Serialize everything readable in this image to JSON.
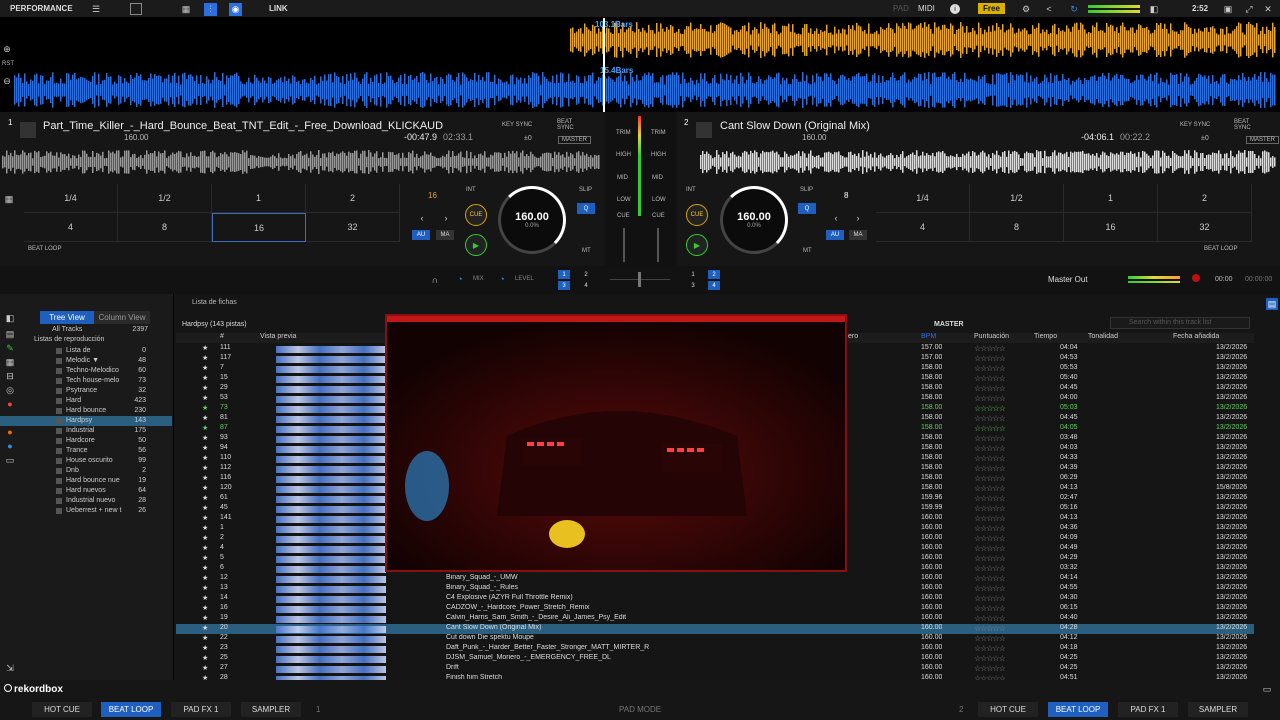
{
  "topbar": {
    "mode": "PERFORMANCE",
    "link": "LINK",
    "pad": "PAD",
    "midi": "MIDI",
    "plan": "Free",
    "time": "2:52"
  },
  "waveform": {
    "deckA_bars": "103.1Bars",
    "deckB_bars": "15.4Bars",
    "rst": "RST"
  },
  "deck1": {
    "num": "1",
    "title": "Part_Time_Killer_-_Hard_Bounce_Beat_TNT_Edit_-_Free_Download_KLICKAUD",
    "bpm_small": "160.00",
    "remaining": "-00:47.9",
    "elapsed": "02:33.1",
    "key_sync": "KEY SYNC",
    "beat_sync": "BEAT SYNC",
    "pm": "±0",
    "master": "MASTER",
    "pads": [
      "1/4",
      "1/2",
      "1",
      "2",
      "4",
      "8",
      "16",
      "32"
    ],
    "selected_pad": 6,
    "loop_size": "16",
    "int": "INT",
    "cue": "CUE",
    "slip": "SLIP",
    "q": "Q",
    "au": "AU",
    "ma": "MA",
    "mt": "MT",
    "bpm": "160.00",
    "pitch": "0.0%",
    "pitch_range": "±6",
    "beat_loop": "BEAT LOOP"
  },
  "deck2": {
    "num": "2",
    "title": "Cant Slow Down (Original Mix)",
    "bpm_small": "160.00",
    "remaining": "-04:06.1",
    "elapsed": "00:22.2",
    "key_sync": "KEY SYNC",
    "beat_sync": "BEAT SYNC",
    "pm": "±0",
    "master": "MASTER",
    "pads": [
      "1/4",
      "1/2",
      "1",
      "2",
      "4",
      "8",
      "16",
      "32"
    ],
    "loop_size": "8",
    "int": "INT",
    "cue": "CUE",
    "slip": "SLIP",
    "q": "Q",
    "au": "AU",
    "ma": "MA",
    "mt": "MT",
    "bpm": "160.00",
    "pitch": "0.0%",
    "pitch_range": "±6",
    "beat_loop": "BEAT LOOP"
  },
  "mixer": {
    "trim": "TRIM",
    "high": "HIGH",
    "mid": "MID",
    "low": "LOW",
    "cue": "CUE",
    "mix": "MIX",
    "level": "LEVEL",
    "master_out": "Master Out",
    "clock": "00:00",
    "clock2": "00:00:00",
    "fx": [
      "1",
      "2",
      "3",
      "4"
    ]
  },
  "browser": {
    "tree_view": "Tree View",
    "column_view": "Column View",
    "list_label": "Lista de fichas",
    "playlist_label": "Hardpsy (143 pistas)",
    "master": "MASTER",
    "search_placeholder": "Search within this track list",
    "all_tracks": {
      "label": "All Tracks",
      "count": "2397"
    },
    "playlists_label": "Listas de reproducción",
    "playlists": [
      {
        "l": "Lista de",
        "c": "0"
      },
      {
        "l": "Melodic ▼",
        "c": "48"
      },
      {
        "l": "Techno-Melodico",
        "c": "60"
      },
      {
        "l": "Tech house-melo",
        "c": "73"
      },
      {
        "l": "Psytrance",
        "c": "32"
      },
      {
        "l": "Hard",
        "c": "423"
      },
      {
        "l": "Hard bounce",
        "c": "230"
      },
      {
        "l": "Hardpsy",
        "c": "143"
      },
      {
        "l": "Industrial",
        "c": "175"
      },
      {
        "l": "Hardcore",
        "c": "50"
      },
      {
        "l": "Trance",
        "c": "56"
      },
      {
        "l": "House oscurito",
        "c": "99"
      },
      {
        "l": "Dnb",
        "c": "2"
      },
      {
        "l": "Hard bounce nue",
        "c": "19"
      },
      {
        "l": "Hard nuevos",
        "c": "64"
      },
      {
        "l": "Industrial nuevo",
        "c": "28"
      },
      {
        "l": "Ueberrest + new t",
        "c": "26"
      }
    ],
    "columns": {
      "num": "#",
      "preview": "Vista previa",
      "genre": "ero",
      "bpm": "BPM",
      "rating": "Puntuación",
      "time": "Tiempo",
      "key": "Tonalidad",
      "date": "Fecha añadida"
    },
    "rows": [
      {
        "n": "111",
        "t": "",
        "b": "157.00",
        "d": "04:04",
        "f": "13/2/2026"
      },
      {
        "n": "117",
        "t": "",
        "b": "157.00",
        "d": "04:53",
        "f": "13/2/2026"
      },
      {
        "n": "7",
        "t": "",
        "b": "158.00",
        "d": "05:53",
        "f": "13/2/2026"
      },
      {
        "n": "15",
        "t": "",
        "b": "158.00",
        "d": "05:40",
        "f": "13/2/2026"
      },
      {
        "n": "29",
        "t": "",
        "b": "158.00",
        "d": "04:45",
        "f": "13/2/2026"
      },
      {
        "n": "53",
        "t": "",
        "b": "158.00",
        "d": "04:00",
        "f": "13/2/2026"
      },
      {
        "n": "73",
        "t": "",
        "b": "158.00",
        "d": "05:03",
        "f": "13/2/2026",
        "g": true
      },
      {
        "n": "81",
        "t": "",
        "b": "158.00",
        "d": "04:45",
        "f": "13/2/2026"
      },
      {
        "n": "87",
        "t": "",
        "b": "158.00",
        "d": "04:05",
        "f": "13/2/2026",
        "g": true
      },
      {
        "n": "93",
        "t": "",
        "b": "158.00",
        "d": "03:48",
        "f": "13/2/2026"
      },
      {
        "n": "94",
        "t": "",
        "b": "158.00",
        "d": "04:03",
        "f": "13/2/2026"
      },
      {
        "n": "110",
        "t": "",
        "b": "158.00",
        "d": "04:33",
        "f": "13/2/2026"
      },
      {
        "n": "112",
        "t": "",
        "b": "158.00",
        "d": "04:39",
        "f": "13/2/2026"
      },
      {
        "n": "116",
        "t": "",
        "b": "158.00",
        "d": "06:29",
        "f": "13/2/2026"
      },
      {
        "n": "120",
        "t": "",
        "b": "158.00",
        "d": "04:13",
        "f": "15/8/2026"
      },
      {
        "n": "61",
        "t": "",
        "b": "159.96",
        "d": "02:47",
        "f": "13/2/2026"
      },
      {
        "n": "45",
        "t": "",
        "b": "159.99",
        "d": "05:16",
        "f": "13/2/2026"
      },
      {
        "n": "141",
        "t": "",
        "b": "160.00",
        "d": "04:13",
        "f": "13/2/2026"
      },
      {
        "n": "1",
        "t": "",
        "b": "160.00",
        "d": "04:36",
        "f": "13/2/2026"
      },
      {
        "n": "2",
        "t": "",
        "b": "160.00",
        "d": "04:09",
        "f": "13/2/2026"
      },
      {
        "n": "4",
        "t": "",
        "b": "160.00",
        "d": "04:49",
        "f": "13/2/2026"
      },
      {
        "n": "5",
        "t": "",
        "b": "160.00",
        "d": "04:29",
        "f": "13/2/2026"
      },
      {
        "n": "6",
        "t": "",
        "b": "160.00",
        "d": "03:32",
        "f": "13/2/2026"
      },
      {
        "n": "12",
        "t": "Binary_Squad_-_UMW",
        "b": "160.00",
        "d": "04:14",
        "f": "13/2/2026"
      },
      {
        "n": "13",
        "t": "Binary_Squad_-_Rules",
        "b": "160.00",
        "d": "04:55",
        "f": "13/2/2026"
      },
      {
        "n": "14",
        "t": "C4 Explosive (AZYR Full Throttle Remix)",
        "b": "160.00",
        "d": "04:30",
        "f": "13/2/2026"
      },
      {
        "n": "16",
        "t": "CADZOW_-_Hardcore_Power_Stretch_Remix",
        "b": "160.00",
        "d": "06:15",
        "f": "13/2/2026"
      },
      {
        "n": "19",
        "t": "Calvin_Harris_Sam_Smith_-_Desire_Ali_James_Psy_Edit",
        "b": "160.00",
        "d": "04:40",
        "f": "13/2/2026"
      },
      {
        "n": "20",
        "t": "Cant Slow Down (Original Mix)",
        "b": "160.00",
        "d": "04:28",
        "f": "13/2/2026",
        "s": true
      },
      {
        "n": "22",
        "t": "Cut down Die spektu Moupe",
        "b": "160.00",
        "d": "04:12",
        "f": "13/2/2026"
      },
      {
        "n": "23",
        "t": "Daft_Punk_-_Harder_Better_Faster_Stronger_MATT_MIRTER_R",
        "b": "160.00",
        "d": "04:18",
        "f": "13/2/2026"
      },
      {
        "n": "25",
        "t": "DJSM_Samuel_Moriero_-_EMERGENCY_FREE_DL",
        "b": "160.00",
        "d": "04:25",
        "f": "13/2/2026"
      },
      {
        "n": "27",
        "t": "Drift",
        "b": "160.00",
        "d": "04:25",
        "f": "13/2/2026"
      },
      {
        "n": "28",
        "t": "Finish him Stretch",
        "b": "160.00",
        "d": "04:51",
        "f": "13/2/2026"
      }
    ]
  },
  "footer": {
    "logo": "rekordbox",
    "left": [
      "HOT CUE",
      "BEAT LOOP",
      "PAD FX 1",
      "SAMPLER"
    ],
    "right": [
      "HOT CUE",
      "BEAT LOOP",
      "PAD FX 1",
      "SAMPLER"
    ],
    "left_num": "1",
    "right_num": "2",
    "pad_mode": "PAD MODE"
  },
  "colors": {
    "accent": "#1f5fbf",
    "waveA": "#e8a531",
    "waveB": "#2e6fe0",
    "selected_row": "#2a5f80"
  }
}
